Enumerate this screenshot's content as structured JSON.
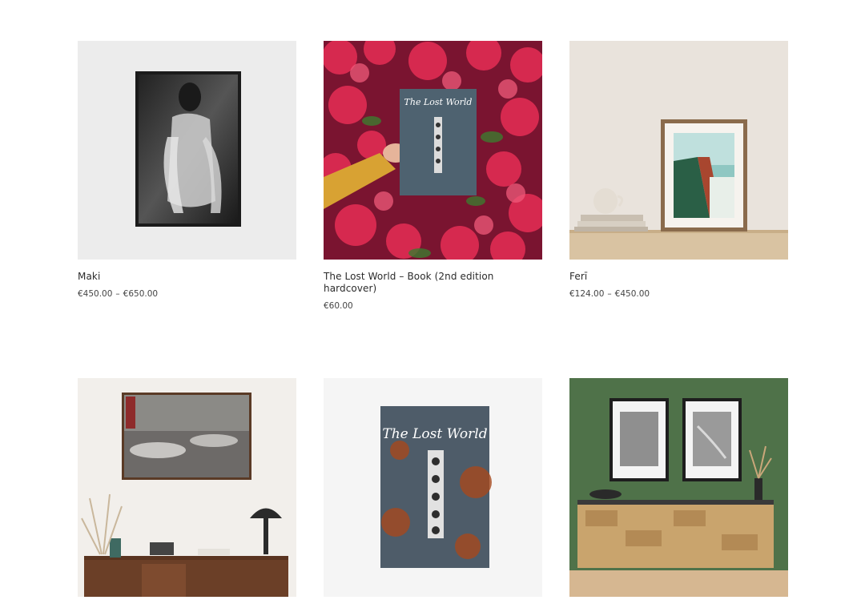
{
  "products": [
    {
      "title": "Maki",
      "price_min": "€450.00",
      "price_sep": "–",
      "price_max": "€650.00",
      "image": "framed-bw-portrait-on-white-wall"
    },
    {
      "title": "The Lost World – Book (2nd edition hardcover)",
      "price_min": "€60.00",
      "price_sep": "",
      "price_max": "",
      "image": "hand-holding-book-among-red-flowers",
      "book_title": "The Lost World"
    },
    {
      "title": "Ferī",
      "price_min": "€124.00",
      "price_sep": "–",
      "price_max": "€450.00",
      "image": "framed-sea-print-on-shelf-with-mug"
    },
    {
      "title": "",
      "price_min": "",
      "price_sep": "",
      "price_max": "",
      "image": "framed-abandoned-dining-room-above-sideboard"
    },
    {
      "title": "",
      "price_min": "",
      "price_sep": "",
      "price_max": "",
      "image": "lost-world-book-cover-on-white",
      "book_title": "The Lost World"
    },
    {
      "title": "",
      "price_min": "",
      "price_sep": "",
      "price_max": "",
      "image": "two-framed-bw-prints-on-green-wall-with-sideboard"
    }
  ],
  "colors": {
    "text": "#2b2b2b",
    "price": "#444444",
    "green_wall": "#4f7249",
    "flower_red": "#d6294f"
  }
}
